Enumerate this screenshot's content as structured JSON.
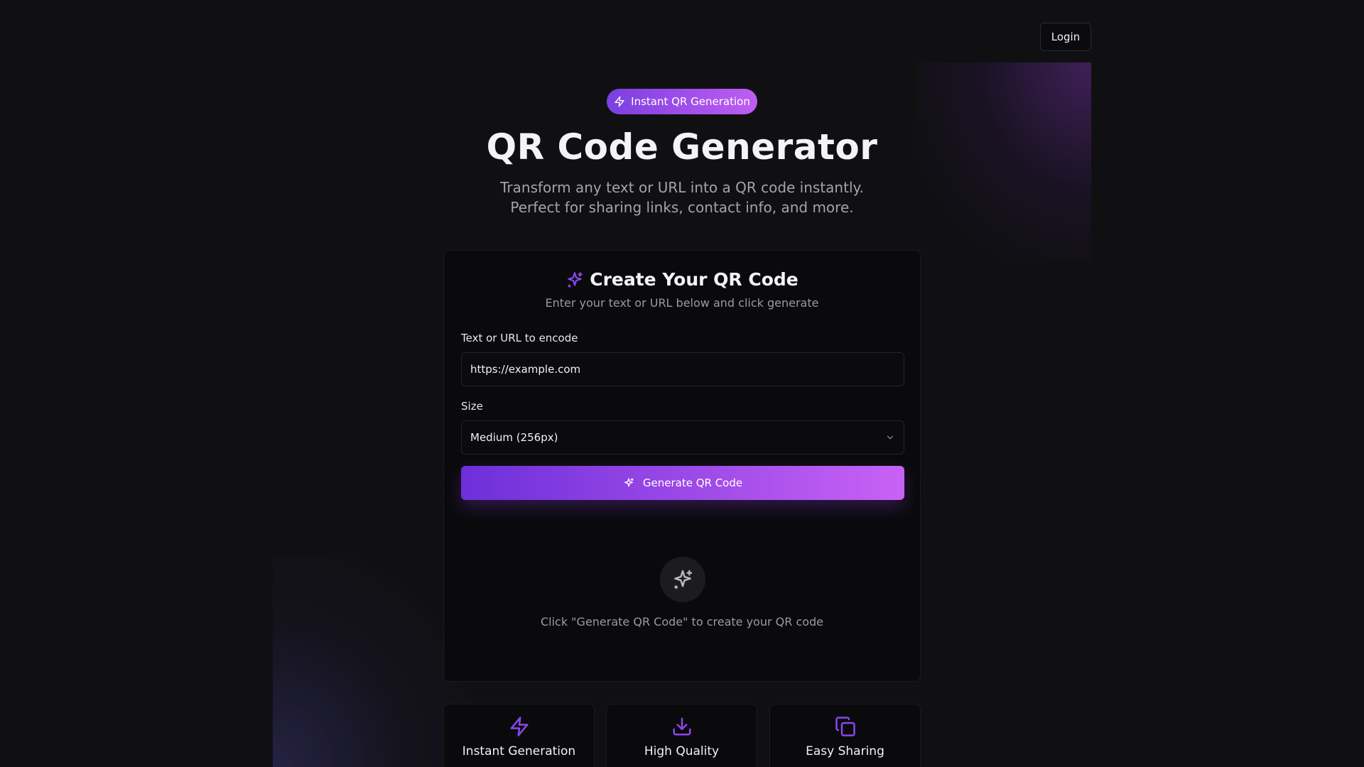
{
  "header": {
    "login_label": "Login"
  },
  "hero": {
    "badge_label": "Instant QR Generation",
    "title": "QR Code Generator",
    "subtitle_line1": "Transform any text or URL into a QR code instantly.",
    "subtitle_line2": "Perfect for sharing links, contact info, and more."
  },
  "form": {
    "title": "Create Your QR Code",
    "subtitle": "Enter your text or URL below and click generate",
    "text_label": "Text or URL to encode",
    "text_value": "https://example.com",
    "size_label": "Size",
    "size_selected": "Medium (256px)",
    "generate_label": "Generate QR Code",
    "empty_hint": "Click \"Generate QR Code\" to create your QR code"
  },
  "features": [
    {
      "title": "Instant Generation",
      "icon": "lightning-icon"
    },
    {
      "title": "High Quality",
      "icon": "download-icon"
    },
    {
      "title": "Easy Sharing",
      "icon": "copy-icon"
    }
  ],
  "colors": {
    "background": "#101013",
    "card": "#0a0a0c",
    "accent_start": "#6d2fd9",
    "accent_end": "#c862f5",
    "icon_purple": "#8b46ef"
  }
}
